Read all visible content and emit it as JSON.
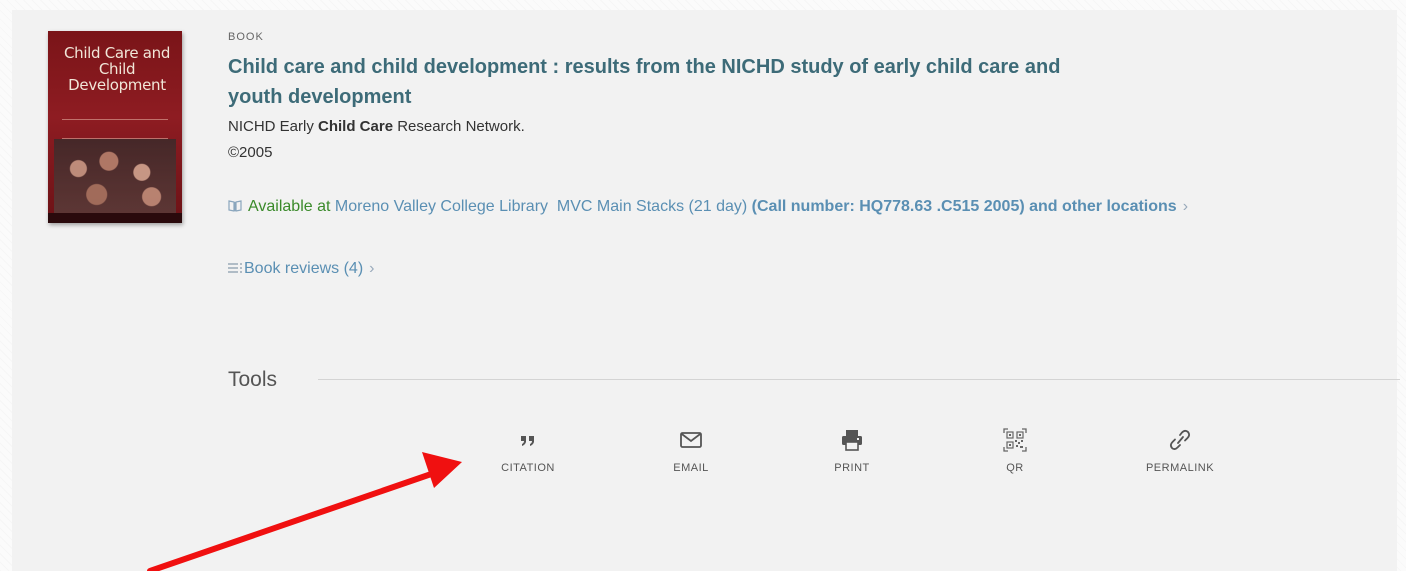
{
  "record": {
    "type": "BOOK",
    "title_parts": [
      "Child care",
      " and ",
      "child",
      " development : results from the NICHD study of early ",
      "child care",
      " and",
      "youth development"
    ],
    "author_prefix": "NICHD Early ",
    "author_highlight": "Child Care",
    "author_suffix": " Research Network.",
    "date": "©2005"
  },
  "cover": {
    "title": "Child Care and Child Development"
  },
  "availability": {
    "status": "Available at",
    "library": "Moreno Valley College Library",
    "location": "MVC Main Stacks (21 day)",
    "call_number": "(Call number: HQ778.63 .C515 2005)",
    "more": "and other locations",
    "chevron": "›"
  },
  "reviews": {
    "label": "Book reviews (4)",
    "chevron": "›"
  },
  "tools": {
    "heading": "Tools",
    "items": [
      {
        "label": "CITATION",
        "icon": "quote-icon"
      },
      {
        "label": "EMAIL",
        "icon": "envelope-icon"
      },
      {
        "label": "PRINT",
        "icon": "printer-icon"
      },
      {
        "label": "QR",
        "icon": "qr-code-icon"
      },
      {
        "label": "PERMALINK",
        "icon": "link-icon"
      }
    ]
  },
  "annotation": {
    "color": "#f01010"
  },
  "colors": {
    "link": "#5a8fb3",
    "title": "#3d6b78",
    "available": "#3a8a2a"
  }
}
